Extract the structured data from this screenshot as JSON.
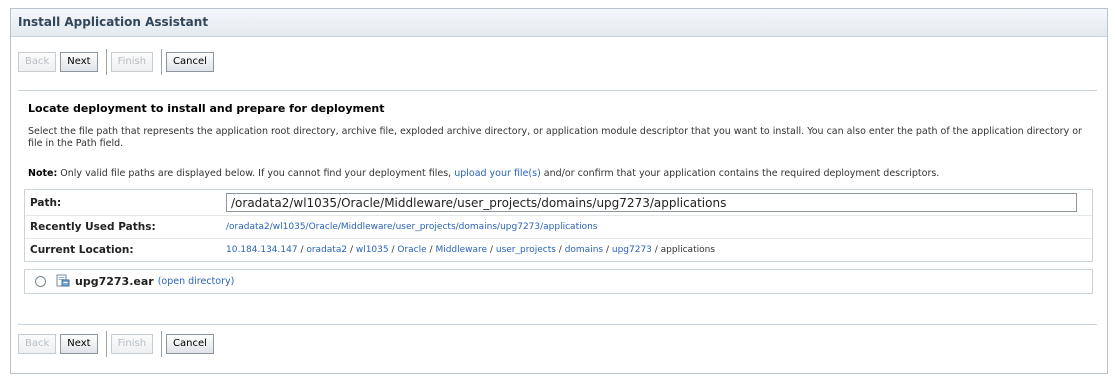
{
  "title": "Install Application Assistant",
  "buttons": {
    "back": "Back",
    "next": "Next",
    "finish": "Finish",
    "cancel": "Cancel"
  },
  "section": {
    "heading": "Locate deployment to install and prepare for deployment",
    "description": "Select the file path that represents the application root directory, archive file, exploded archive directory, or application module descriptor that you want to install. You can also enter the path of the application directory or file in the Path field.",
    "note_label": "Note:",
    "note_text_1": " Only valid file paths are displayed below. If you cannot find your deployment files, ",
    "note_link": "upload your file(s)",
    "note_text_2": " and/or confirm that your application contains the required deployment descriptors."
  },
  "path": {
    "label": "Path:",
    "value": "/oradata2/wl1035/Oracle/Middleware/user_projects/domains/upg7273/applications"
  },
  "recent": {
    "label": "Recently Used Paths:",
    "value": "/oradata2/wl1035/Oracle/Middleware/user_projects/domains/upg7273/applications"
  },
  "location": {
    "label": "Current Location:",
    "segments": [
      "10.184.134.147",
      "oradata2",
      "wl1035",
      "Oracle",
      "Middleware",
      "user_projects",
      "domains",
      "upg7273"
    ],
    "separator": " / ",
    "current": "applications"
  },
  "file": {
    "name": "upg7273.ear",
    "action": "(open directory)"
  },
  "icons": {
    "file": "archive-file-icon",
    "radio": "radio-button"
  }
}
